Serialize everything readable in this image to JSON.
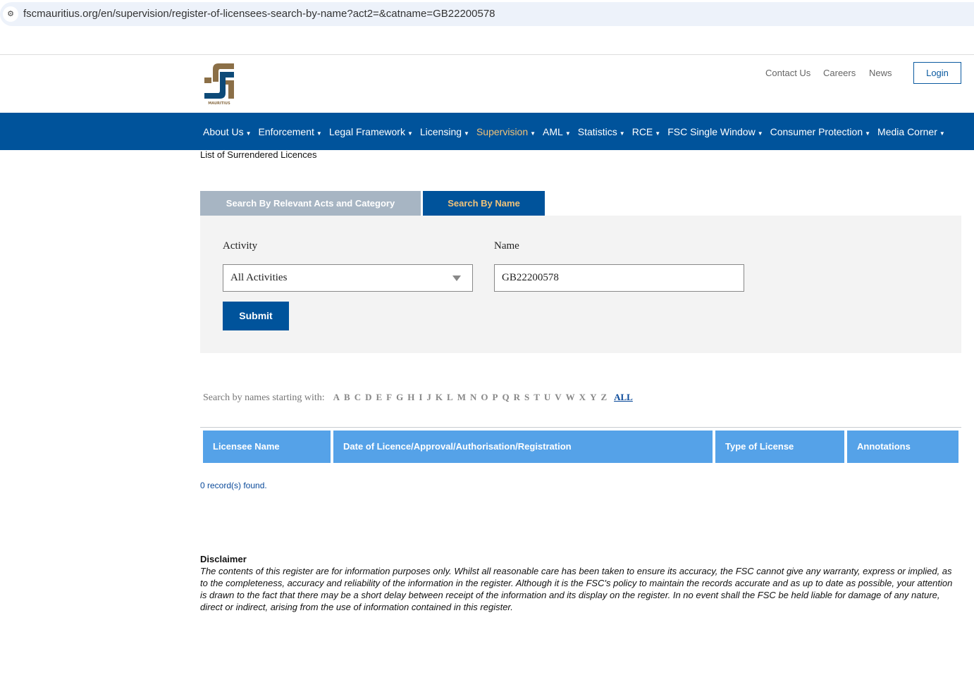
{
  "browser": {
    "url": "fscmauritius.org/en/supervision/register-of-licensees-search-by-name?act2=&catname=GB22200578"
  },
  "header": {
    "logo_text": "MAURITIUS",
    "links": [
      "Contact Us",
      "Careers",
      "News"
    ],
    "login": "Login"
  },
  "nav": {
    "items": [
      "About Us",
      "Enforcement",
      "Legal Framework",
      "Licensing",
      "Supervision",
      "AML",
      "Statistics",
      "RCE",
      "FSC Single Window",
      "Consumer Protection",
      "Media Corner"
    ],
    "active": "Supervision"
  },
  "breadcrumb": "List of Surrendered Licences",
  "tabs": [
    "Search By Relevant Acts and Category",
    "Search By Name"
  ],
  "form": {
    "activity_label": "Activity",
    "activity_value": "All Activities",
    "name_label": "Name",
    "name_value": "GB22200578",
    "submit": "Submit"
  },
  "alpha": {
    "label": "Search by names starting with:",
    "letters": [
      "A",
      "B",
      "C",
      "D",
      "E",
      "F",
      "G",
      "H",
      "I",
      "J",
      "K",
      "L",
      "M",
      "N",
      "O",
      "P",
      "Q",
      "R",
      "S",
      "T",
      "U",
      "V",
      "W",
      "X",
      "Y",
      "Z"
    ],
    "all": "ALL"
  },
  "table": {
    "headers": [
      "Licensee Name",
      "Date of Licence/Approval/Authorisation/Registration",
      "Type of License",
      "Annotations"
    ]
  },
  "records": "0 record(s) found.",
  "disclaimer": {
    "title": "Disclaimer",
    "text": "The contents of this register are for information purposes only. Whilst all reasonable care has been taken to ensure its accuracy, the FSC cannot give any warranty, express or implied, as to the completeness, accuracy and reliability of the information in the register. Although it is the FSC's policy to maintain the records accurate and as up to date as possible, your attention is drawn to the fact that there may be a short delay between receipt of the information and its display on the register. In no event shall the FSC be held liable for damage of any nature, direct or indirect, arising from the use of information contained in this register."
  },
  "colors": {
    "brand": "#00539b",
    "header_cell": "#55a2e8",
    "active_nav": "#f0c27a"
  }
}
